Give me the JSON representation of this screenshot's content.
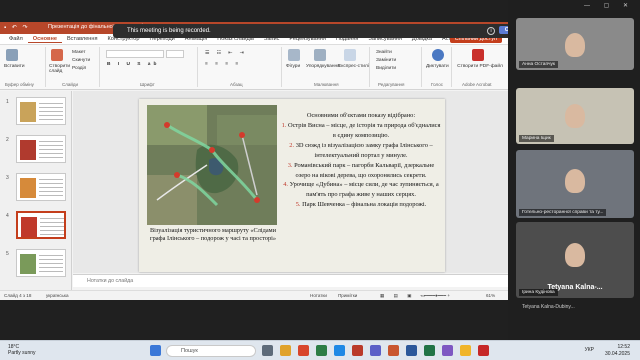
{
  "recording_banner": {
    "message": "This meeting is being recorded.",
    "ok_label": "OK",
    "info_glyph": "i"
  },
  "ppt": {
    "title": "Презентація до фінальної звіту... • Збережено",
    "tabs": [
      "Файл",
      "Основне",
      "Вставлення",
      "Конструктор",
      "Переходи",
      "Анімація",
      "Показ слайдів",
      "Запис",
      "Рецензування",
      "Подання",
      "Записування",
      "Довідка",
      "Acrobat"
    ],
    "active_tab": "Основне",
    "share_label": "Спільний доступ",
    "ribbon": {
      "groups": [
        "Буфер обміну",
        "Слайди",
        "Шрифт",
        "Абзац",
        "Малювання",
        "Редагування",
        "Голос",
        "Adobe Acrobat"
      ],
      "items": {
        "paste": "Вставити",
        "new_slide": "Створити слайд",
        "layout": "Макет",
        "reset": "Скинути",
        "section": "Розділ",
        "shapes": "Фігури",
        "arrange": "Упорядкування",
        "styles": "Експрес-стилі",
        "find": "Знайти",
        "replace": "Замінити",
        "select": "Виділити",
        "dictate": "Диктувати",
        "create_pdf": "Створити PDF-файл"
      }
    },
    "thumbnails": [
      {
        "num": "1",
        "color": "#c9a35a"
      },
      {
        "num": "2",
        "color": "#b03a2e"
      },
      {
        "num": "3",
        "color": "#d68a3a"
      },
      {
        "num": "4",
        "color": "#c0392b"
      },
      {
        "num": "5",
        "color": "#7a9a5a"
      }
    ],
    "selected_slide": 4,
    "slide": {
      "caption": "Візуалізація туристичного маршруту «Слідами графа Ілінського – подорож у часі та просторі»",
      "heading": "Основними об'єктами показу відібрано:",
      "items": [
        {
          "num": "1.",
          "text": "Острів Висна – місце, де історія та природа об'єдналися в єдину композицію."
        },
        {
          "num": "2.",
          "text": "3D сюжд із візуалізацією замку графа Ілінського – інтелектуальний портал у минуле."
        },
        {
          "num": "3.",
          "text": "Романівський парк – пагорби Кальварії, дзеркальне озеро на вікові дерева, що охоронялись секрети."
        },
        {
          "num": "4.",
          "text": "Урочище «Дубина» – місце сили, де час зупиняється, а пам'ять про графа живе у наших серцях."
        },
        {
          "num": "5.",
          "text": "Парк Шевченка – фінальна локація подорожі."
        }
      ]
    },
    "notes_placeholder": "Нотатки до слайда",
    "status": {
      "slide_counter": "Слайд 4 з 18",
      "language": "українська",
      "notes_btn": "Нотатки",
      "comments_btn": "Примітки",
      "zoom": "61%"
    }
  },
  "participants": [
    {
      "name": "Анна Остапчук",
      "bg": "#8a8a8a"
    },
    {
      "name": "Марина Іщик",
      "bg": "#c6c2b4"
    },
    {
      "name": "Готельно-ресторанної справи та ту...",
      "bg": "#6f747c"
    },
    {
      "name": "Ірина Кудінова",
      "bg": "#4d4d4d"
    },
    {
      "name": "Tetyana Kalna-...",
      "bg": "#2a2a2a"
    },
    {
      "name": "Tetyana Kalna-Dubiny...",
      "bg": "#2a2a2a"
    }
  ],
  "taskbar": {
    "weather_temp": "18°C",
    "weather_desc": "Partly sunny",
    "search_label": "Пошук",
    "language": "УКР",
    "time": "12:52",
    "date": "30.04.2025"
  }
}
